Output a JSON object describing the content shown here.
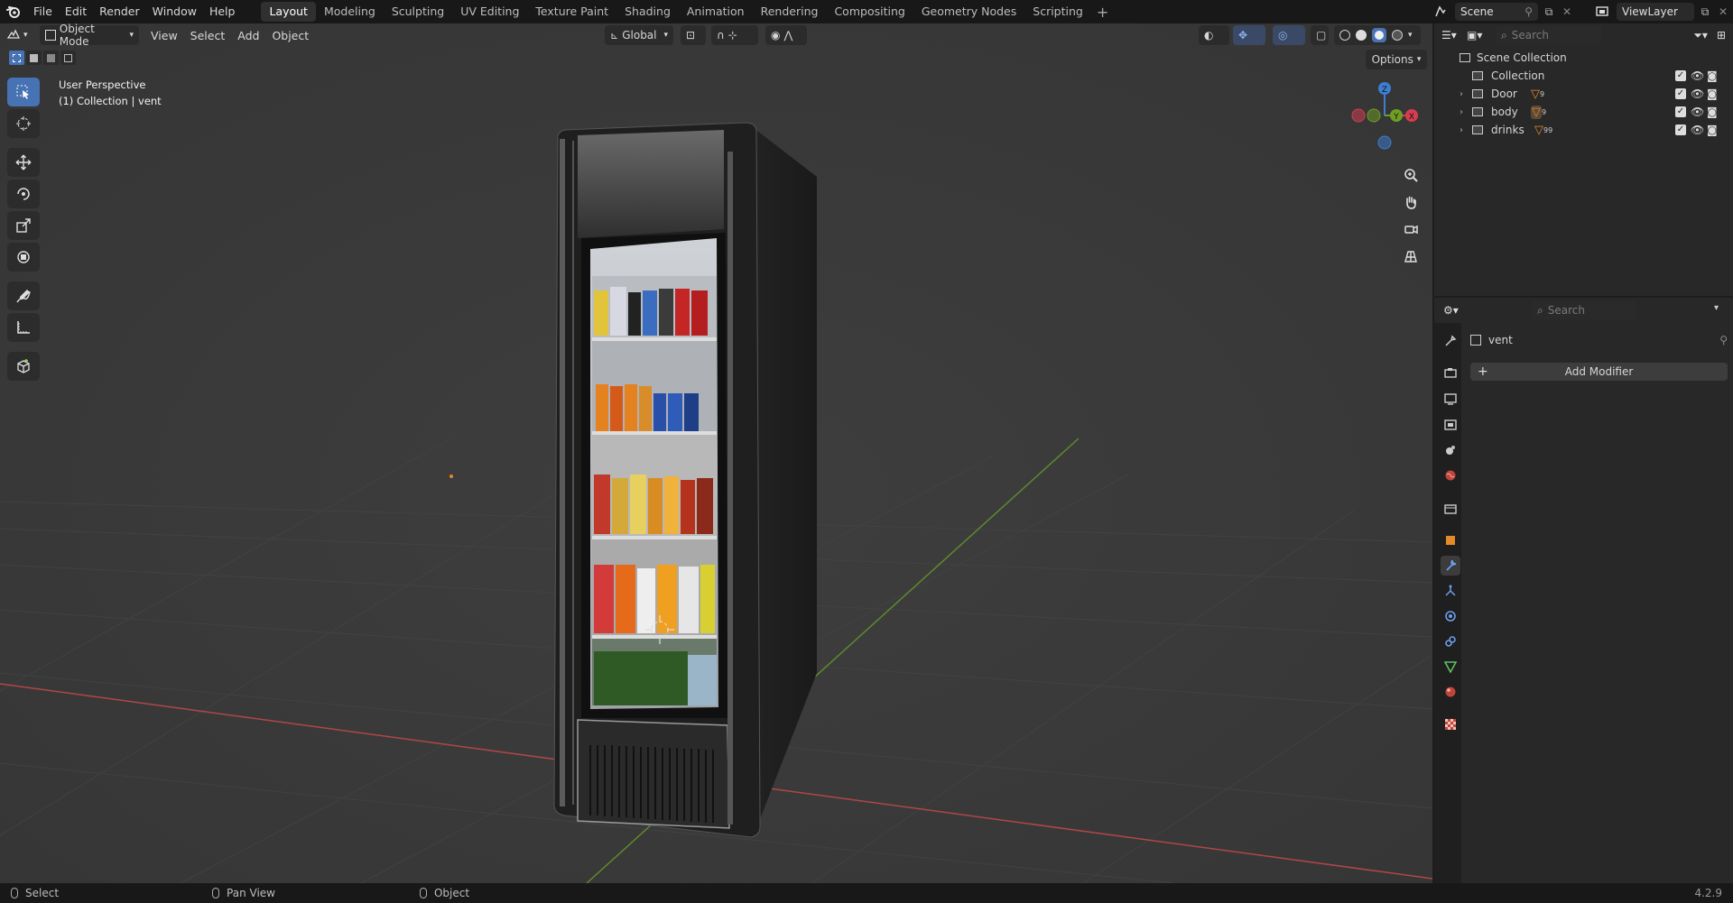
{
  "menus": [
    "File",
    "Edit",
    "Render",
    "Window",
    "Help"
  ],
  "workspaces": [
    "Layout",
    "Modeling",
    "Sculpting",
    "UV Editing",
    "Texture Paint",
    "Shading",
    "Animation",
    "Rendering",
    "Compositing",
    "Geometry Nodes",
    "Scripting"
  ],
  "active_workspace": "Layout",
  "scene": {
    "name": "Scene"
  },
  "view_layer": {
    "name": "ViewLayer"
  },
  "viewport_header": {
    "mode": "Object Mode",
    "menus": [
      "View",
      "Select",
      "Add",
      "Object"
    ],
    "orientation": "Global",
    "options_label": "Options"
  },
  "viewport": {
    "perspective": "User Perspective",
    "context": "(1) Collection | vent",
    "gizmo_axes": {
      "z": "Z",
      "y": "Y",
      "x": "X"
    }
  },
  "outliner": {
    "search_placeholder": "Search",
    "root": "Scene Collection",
    "collection": "Collection",
    "items": [
      {
        "name": "Door",
        "badge": "9"
      },
      {
        "name": "body",
        "badge": "9"
      },
      {
        "name": "drinks",
        "badge": "99"
      }
    ]
  },
  "properties": {
    "search_placeholder": "Search",
    "object_name": "vent",
    "add_modifier_label": "Add Modifier"
  },
  "statusbar": {
    "select": "Select",
    "pan": "Pan View",
    "object": "Object",
    "version": "4.2.9"
  },
  "colors": {
    "accent": "#4772b3",
    "x_axis": "#d63d50",
    "y_axis": "#6f9e24",
    "z_axis": "#3c7ed4",
    "object_orange": "#e38a29"
  }
}
